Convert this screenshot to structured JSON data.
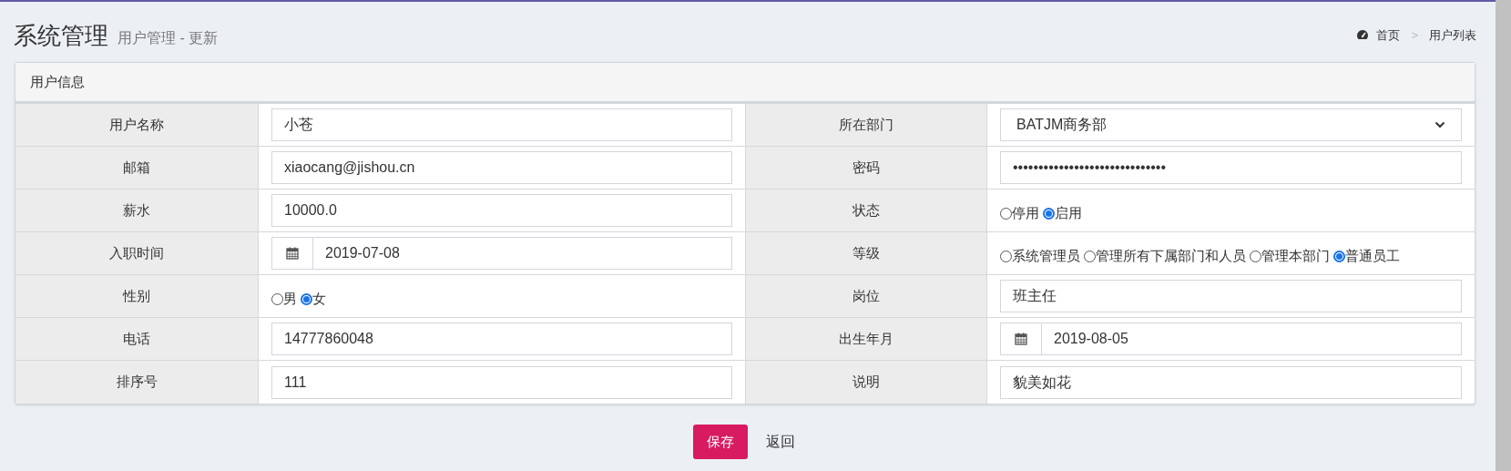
{
  "header": {
    "title": "系统管理",
    "subtitle": "用户管理 - 更新"
  },
  "breadcrumb": [
    {
      "label": "首页",
      "kind": "home"
    },
    {
      "label": ">",
      "kind": "separator"
    },
    {
      "label": "用户列表",
      "kind": "link"
    }
  ],
  "card": {
    "title": "用户信息"
  },
  "rows": [
    [
      {
        "label": "用户名称",
        "kind": "text",
        "value": "小苍"
      },
      {
        "label": "所在部门",
        "kind": "select",
        "value": "BATJM商务部"
      }
    ],
    [
      {
        "label": "邮箱",
        "kind": "text",
        "value": "xiaocang@jishou.cn"
      },
      {
        "label": "密码",
        "kind": "password",
        "value": "••••••••••••••••••••••••••••••"
      }
    ],
    [
      {
        "label": "薪水",
        "kind": "text",
        "value": "10000.0"
      },
      {
        "label": "状态",
        "kind": "radio",
        "options": [
          {
            "label": "停用",
            "selected": false
          },
          {
            "label": "启用",
            "selected": true
          }
        ]
      }
    ],
    [
      {
        "label": "入职时间",
        "kind": "date",
        "value": "2019-07-08"
      },
      {
        "label": "等级",
        "kind": "radio",
        "options": [
          {
            "label": "系统管理员",
            "selected": false
          },
          {
            "label": "管理所有下属部门和人员",
            "selected": false
          },
          {
            "label": "管理本部门",
            "selected": false
          },
          {
            "label": "普通员工",
            "selected": true
          }
        ]
      }
    ],
    [
      {
        "label": "性别",
        "kind": "radio",
        "options": [
          {
            "label": "男",
            "selected": false
          },
          {
            "label": "女",
            "selected": true
          }
        ]
      },
      {
        "label": "岗位",
        "kind": "text",
        "value": "班主任"
      }
    ],
    [
      {
        "label": "电话",
        "kind": "text",
        "value": "14777860048"
      },
      {
        "label": "出生年月",
        "kind": "date",
        "value": "2019-08-05"
      }
    ],
    [
      {
        "label": "排序号",
        "kind": "text",
        "value": "111"
      },
      {
        "label": "说明",
        "kind": "text",
        "value": "貌美如花"
      }
    ]
  ],
  "buttons": [
    {
      "label": "保存",
      "kind": "primary"
    },
    {
      "label": "返回",
      "kind": "plain"
    }
  ]
}
